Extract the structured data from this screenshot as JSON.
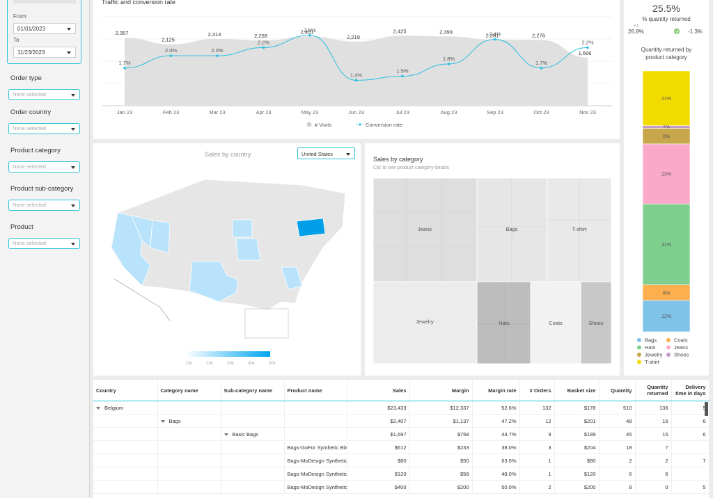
{
  "sidebar": {
    "from_label": "From",
    "from_value": "01/01/2023",
    "to_label": "To",
    "to_value": "11/23/2023",
    "filters": [
      {
        "label": "Order type",
        "placeholder": "None selected"
      },
      {
        "label": "Order country",
        "placeholder": "None selected"
      },
      {
        "label": "Product category",
        "placeholder": "None selected"
      },
      {
        "label": "Product sub-category",
        "placeholder": "None selected"
      },
      {
        "label": "Product",
        "placeholder": "None selected"
      }
    ]
  },
  "traffic": {
    "title": "Traffic and conversion rate",
    "legend_visits": "# Visits",
    "legend_conversion": "Conversion rate",
    "colors": {
      "area": "#e0e0e0",
      "line": "#29bfe0"
    }
  },
  "chart_data": {
    "type": "area",
    "categories": [
      "Jan 23",
      "Feb 23",
      "Mar 23",
      "Apr 23",
      "May 23",
      "Jun 23",
      "Jul 23",
      "Aug 23",
      "Sep 23",
      "Oct 23",
      "Nov 23"
    ],
    "series": [
      {
        "name": "# Visits",
        "values": [
          2357,
          2125,
          2314,
          2258,
          2401,
          2219,
          2425,
          2399,
          2281,
          2276,
          1666
        ],
        "labels": [
          "2,357",
          "2,125",
          "2,314",
          "2,258",
          "2,401",
          "2,219",
          "2,425",
          "2,399",
          "2,281",
          "2,276",
          "1,666"
        ]
      },
      {
        "name": "Conversion rate",
        "values": [
          1.7,
          2.0,
          2.0,
          2.2,
          2.5,
          1.4,
          1.5,
          1.8,
          2.4,
          1.7,
          2.2
        ],
        "labels": [
          "1.7%",
          "2.0%",
          "2.0%",
          "2.2%",
          "2.5%",
          "1.4%",
          "1.5%",
          "1.8%",
          "2.4%",
          "1.7%",
          "2.2%"
        ]
      }
    ]
  },
  "kpi": {
    "value": "25.5%",
    "label": "% quantity returned",
    "y1_label": "Y-1",
    "y1_value": "26.8%",
    "delta": "-1.3%"
  },
  "returned": {
    "title": "Quantity returned by product category",
    "segments": [
      {
        "name": "T-shirt",
        "pct": 21,
        "label": "21%",
        "color": "#f2dc00"
      },
      {
        "name": "Shoes",
        "pct": 1,
        "label": "1%",
        "color": "#c79bc9"
      },
      {
        "name": "Jewelry",
        "pct": 6,
        "label": "6%",
        "color": "#c8a64c"
      },
      {
        "name": "Jeans",
        "pct": 23,
        "label": "23%",
        "color": "#fba9c9"
      },
      {
        "name": "Hats",
        "pct": 31,
        "label": "31%",
        "color": "#7fd08f"
      },
      {
        "name": "Coats",
        "pct": 6,
        "label": "6%",
        "color": "#fbaf4f"
      },
      {
        "name": "Bags",
        "pct": 12,
        "label": "12%",
        "color": "#7fc3e9"
      }
    ],
    "legend": [
      {
        "name": "Bags",
        "color": "#7fc3e9"
      },
      {
        "name": "Coats",
        "color": "#fbaf4f"
      },
      {
        "name": "Hats",
        "color": "#7fd08f"
      },
      {
        "name": "Jeans",
        "color": "#fba9c9"
      },
      {
        "name": "Jewelry",
        "color": "#c8a64c"
      },
      {
        "name": "Shoes",
        "color": "#c79bc9"
      },
      {
        "name": "T-shirt",
        "color": "#f2dc00"
      }
    ]
  },
  "map": {
    "title": "Sales by country",
    "country_select": "United States",
    "scale_ticks": [
      "10k",
      "20k",
      "30k",
      "40k",
      "50k"
    ]
  },
  "treemap": {
    "title": "Sales by category",
    "subtitle": "Clic to see product category details",
    "labels": [
      "Jeans",
      "Bags",
      "T-shirt",
      "Jewelry",
      "Hats",
      "Coats",
      "Shoes"
    ]
  },
  "table": {
    "headers": [
      "Country",
      "Category name",
      "Sub-category name",
      "Product name",
      "Sales",
      "Margin",
      "Margin rate",
      "# Orders",
      "Basket size",
      "Quantity",
      "Quantity returned",
      "Delivery time in days"
    ],
    "rows": [
      {
        "c0": "Belgium",
        "c1": "",
        "c2": "",
        "c3": "",
        "sales": "$23,433",
        "margin": "$12,337",
        "rate": "52.6%",
        "orders": "132",
        "basket": "$178",
        "qty": "510",
        "ret": "136",
        "days": "5",
        "level": 0
      },
      {
        "c0": "",
        "c1": "Bags",
        "c2": "",
        "c3": "",
        "sales": "$2,407",
        "margin": "$1,137",
        "rate": "47.2%",
        "orders": "12",
        "basket": "$201",
        "qty": "48",
        "ret": "16",
        "days": "6",
        "level": 1
      },
      {
        "c0": "",
        "c1": "",
        "c2": "Basic Bags",
        "c3": "",
        "sales": "$1,697",
        "margin": "$758",
        "rate": "44.7%",
        "orders": "9",
        "basket": "$189",
        "qty": "45",
        "ret": "15",
        "days": "6",
        "level": 2
      },
      {
        "c0": "",
        "c1": "",
        "c2": "",
        "c3": "Bags-GoFor Synthetic Black",
        "sales": "$612",
        "margin": "$233",
        "rate": "38.0%",
        "orders": "3",
        "basket": "$204",
        "qty": "18",
        "ret": "7",
        "days": "",
        "level": 3
      },
      {
        "c0": "",
        "c1": "",
        "c2": "",
        "c3": "Bags-MoDesign Synthetic",
        "sales": "$80",
        "margin": "$50",
        "rate": "63.0%",
        "orders": "1",
        "basket": "$80",
        "qty": "2",
        "ret": "2",
        "days": "7",
        "level": 3
      },
      {
        "c0": "",
        "c1": "",
        "c2": "",
        "c3": "Bags-MoDesign Synthetic",
        "sales": "$120",
        "margin": "$58",
        "rate": "48.0%",
        "orders": "1",
        "basket": "$120",
        "qty": "6",
        "ret": "6",
        "days": "",
        "level": 3
      },
      {
        "c0": "",
        "c1": "",
        "c2": "",
        "c3": "Bags-MoDesign Synthetic",
        "sales": "$400",
        "margin": "$200",
        "rate": "50.0%",
        "orders": "2",
        "basket": "$200",
        "qty": "8",
        "ret": "0",
        "days": "5",
        "level": 3
      }
    ]
  }
}
